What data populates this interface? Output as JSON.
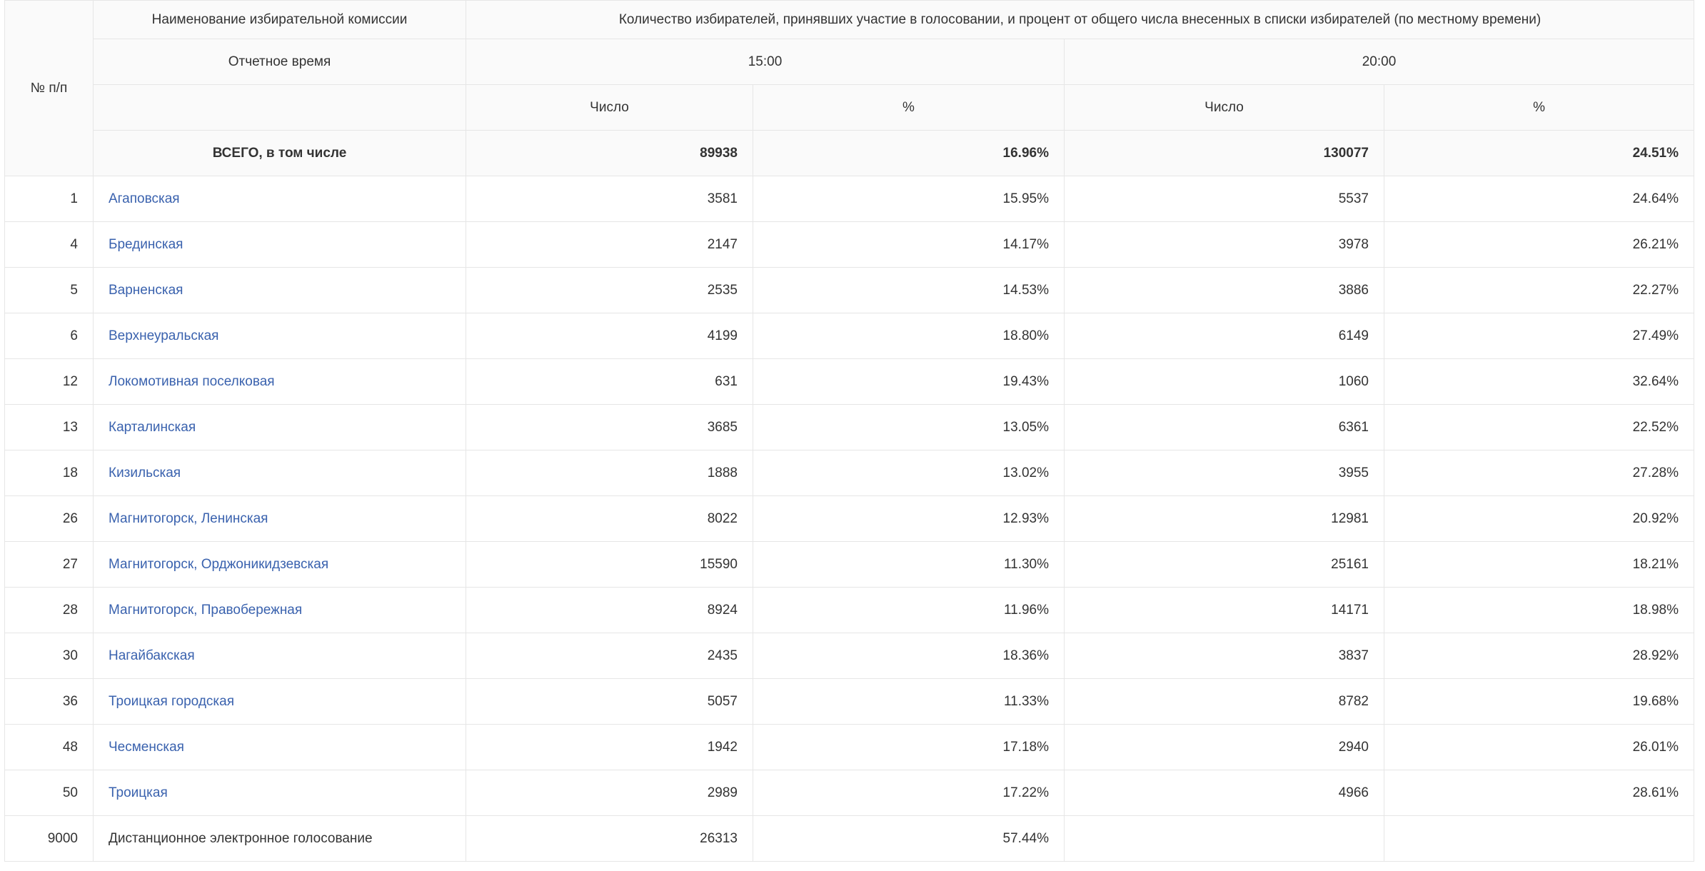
{
  "header": {
    "col_number": "№ п/п",
    "col_name": "Наименование избирательной комиссии",
    "col_group": "Количество избирателей, принявших участие в голосовании, и процент от общего числа внесенных в списки избирателей (по местному времени)",
    "report_time_label": "Отчетное время",
    "time_1": "15:00",
    "time_2": "20:00",
    "count_label": "Число",
    "percent_label": "%"
  },
  "total": {
    "label": "ВСЕГО, в том числе",
    "count_1500": "89938",
    "pct_1500": "16.96%",
    "count_2000": "130077",
    "pct_2000": "24.51%"
  },
  "rows": [
    {
      "num": "1",
      "name": "Агаповская",
      "count_1500": "3581",
      "pct_1500": "15.95%",
      "count_2000": "5537",
      "pct_2000": "24.64%"
    },
    {
      "num": "4",
      "name": "Брединская",
      "count_1500": "2147",
      "pct_1500": "14.17%",
      "count_2000": "3978",
      "pct_2000": "26.21%"
    },
    {
      "num": "5",
      "name": "Варненская",
      "count_1500": "2535",
      "pct_1500": "14.53%",
      "count_2000": "3886",
      "pct_2000": "22.27%"
    },
    {
      "num": "6",
      "name": "Верхнеуральская",
      "count_1500": "4199",
      "pct_1500": "18.80%",
      "count_2000": "6149",
      "pct_2000": "27.49%"
    },
    {
      "num": "12",
      "name": "Локомотивная поселковая",
      "count_1500": "631",
      "pct_1500": "19.43%",
      "count_2000": "1060",
      "pct_2000": "32.64%"
    },
    {
      "num": "13",
      "name": "Карталинская",
      "count_1500": "3685",
      "pct_1500": "13.05%",
      "count_2000": "6361",
      "pct_2000": "22.52%"
    },
    {
      "num": "18",
      "name": "Кизильская",
      "count_1500": "1888",
      "pct_1500": "13.02%",
      "count_2000": "3955",
      "pct_2000": "27.28%"
    },
    {
      "num": "26",
      "name": "Магнитогорск, Ленинская",
      "count_1500": "8022",
      "pct_1500": "12.93%",
      "count_2000": "12981",
      "pct_2000": "20.92%"
    },
    {
      "num": "27",
      "name": "Магнитогорск, Орджоникидзевская",
      "count_1500": "15590",
      "pct_1500": "11.30%",
      "count_2000": "25161",
      "pct_2000": "18.21%"
    },
    {
      "num": "28",
      "name": "Магнитогорск, Правобережная",
      "count_1500": "8924",
      "pct_1500": "11.96%",
      "count_2000": "14171",
      "pct_2000": "18.98%"
    },
    {
      "num": "30",
      "name": "Нагайбакская",
      "count_1500": "2435",
      "pct_1500": "18.36%",
      "count_2000": "3837",
      "pct_2000": "28.92%"
    },
    {
      "num": "36",
      "name": "Троицкая городская",
      "count_1500": "5057",
      "pct_1500": "11.33%",
      "count_2000": "8782",
      "pct_2000": "19.68%"
    },
    {
      "num": "48",
      "name": "Чесменская",
      "count_1500": "1942",
      "pct_1500": "17.18%",
      "count_2000": "2940",
      "pct_2000": "26.01%"
    },
    {
      "num": "50",
      "name": "Троицкая",
      "count_1500": "2989",
      "pct_1500": "17.22%",
      "count_2000": "4966",
      "pct_2000": "28.61%"
    }
  ],
  "remote_row": {
    "num": "9000",
    "name": "Дистанционное электронное голосование",
    "count_1500": "26313",
    "pct_1500": "57.44%",
    "count_2000": "",
    "pct_2000": ""
  },
  "colors": {
    "link": "#3a62ae",
    "text": "#333333",
    "header_bg": "#fafafa",
    "border": "#e6e6e6"
  }
}
